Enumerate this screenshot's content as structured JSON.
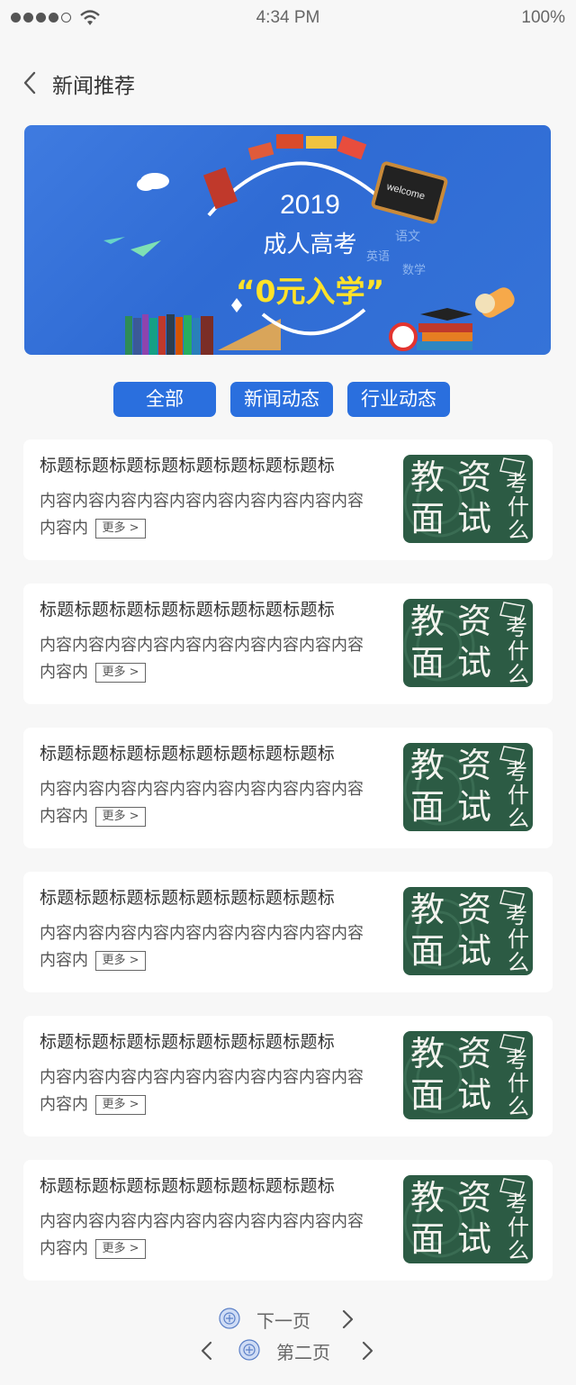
{
  "status_bar": {
    "time": "4:34 PM",
    "battery": "100%"
  },
  "header": {
    "title": "新闻推荐"
  },
  "banner": {
    "year": "2019",
    "line1": "成人高考",
    "line2": "“0元入学”"
  },
  "tabs": [
    {
      "label": "全部"
    },
    {
      "label": "新闻动态"
    },
    {
      "label": "行业动态"
    }
  ],
  "news": [
    {
      "title": "标题标题标题标题标题标题标题标题标",
      "content": "内容内容内容内容内容内容内容内容内容内容内容内",
      "more": "更多 >"
    },
    {
      "title": "标题标题标题标题标题标题标题标题标",
      "content": "内容内容内容内容内容内容内容内容内容内容内容内",
      "more": "更多 >"
    },
    {
      "title": "标题标题标题标题标题标题标题标题标",
      "content": "内容内容内容内容内容内容内容内容内容内容内容内",
      "more": "更多 >"
    },
    {
      "title": "标题标题标题标题标题标题标题标题标",
      "content": "内容内容内容内容内容内容内容内容内容内容内容内",
      "more": "更多 >"
    },
    {
      "title": "标题标题标题标题标题标题标题标题标",
      "content": "内容内容内容内容内容内容内容内容内容内容内容内",
      "more": "更多 >"
    },
    {
      "title": "标题标题标题标题标题标题标题标题标",
      "content": "内容内容内容内容内容内容内容内容内容内容内容内",
      "more": "更多 >"
    }
  ],
  "thumb_text": {
    "big1": "教",
    "big2": "资",
    "big3": "面",
    "big4": "试",
    "small1": "考",
    "small2": "什",
    "small3": "么"
  },
  "pager": {
    "next": "下一页",
    "page": "第二页"
  },
  "colors": {
    "accent": "#2a6fde",
    "thumb_bg": "#2c5b44",
    "banner_text_highlight": "#ffe229"
  },
  "icons": {
    "back": "chevron-left-icon",
    "next": "chevron-right-icon",
    "seal": "seal-icon"
  }
}
